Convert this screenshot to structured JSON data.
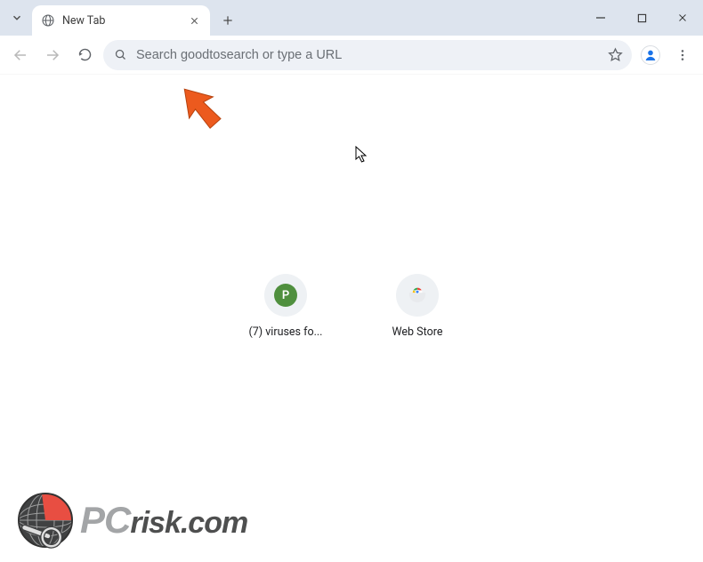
{
  "window": {
    "tab_title": "New Tab"
  },
  "toolbar": {
    "omnibox_placeholder": "Search goodtosearch or type a URL"
  },
  "shortcuts": [
    {
      "label": "(7) viruses fo...",
      "badge_letter": "P",
      "badge_color": "#4f8f3e"
    },
    {
      "label": "Web Store",
      "badge_letter": "",
      "badge_color": "#ffffff"
    }
  ],
  "watermark": {
    "text_main": "PC",
    "text_sub": "risk.com"
  },
  "icons": {
    "favicon": "globe-icon",
    "shortcut2": "chrome-store-icon"
  },
  "colors": {
    "titlebar_bg": "#dde4ee",
    "omnibox_bg": "#eef1f6",
    "arrow": "#ec5a1e"
  }
}
